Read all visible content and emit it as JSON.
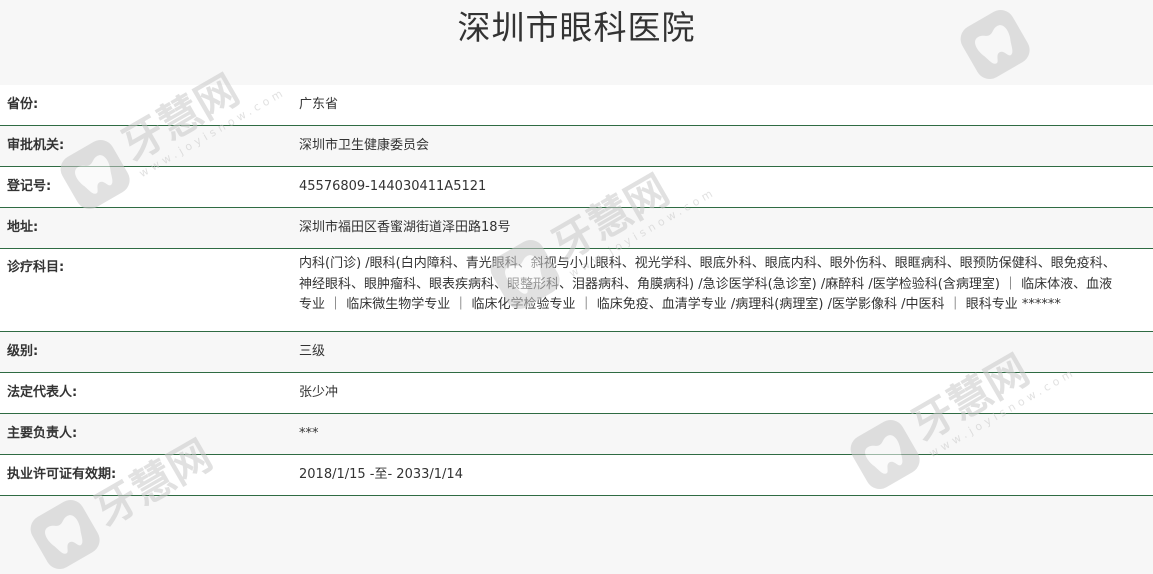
{
  "page": {
    "title": "深圳市眼科医院"
  },
  "rows": [
    {
      "label": "省份:",
      "value": "广东省"
    },
    {
      "label": "审批机关:",
      "value": "深圳市卫生健康委员会"
    },
    {
      "label": "登记号:",
      "value": "45576809-144030411A5121"
    },
    {
      "label": "地址:",
      "value": "深圳市福田区香蜜湖街道泽田路18号"
    },
    {
      "label": "诊疗科目:",
      "value": "内科(门诊) /眼科(白内障科、青光眼科、斜视与小儿眼科、视光学科、眼底外科、眼底内科、眼外伤科、眼眶病科、眼预防保健科、眼免疫科、神经眼科、眼肿瘤科、眼表疾病科、眼整形科、泪器病科、角膜病科) /急诊医学科(急诊室) /麻醉科 /医学检验科(含病理室) ｜ 临床体液、血液专业 ｜ 临床微生物学专业 ｜ 临床化学检验专业 ｜ 临床免疫、血清学专业 /病理科(病理室) /医学影像科 /中医科 ｜ 眼科专业 ******"
    },
    {
      "label": "级别:",
      "value": "三级"
    },
    {
      "label": "法定代表人:",
      "value": "张少冲"
    },
    {
      "label": "主要负责人:",
      "value": "***"
    },
    {
      "label": "执业许可证有效期:",
      "value": "2018/1/15 -至- 2033/1/14"
    }
  ],
  "watermark": {
    "name": "牙慧网",
    "url": "www.joyisnow.com",
    "icon": "tooth-logo-icon",
    "color": "#c9c9c9"
  },
  "colors": {
    "divider": "#2f6b43",
    "text": "#333333"
  }
}
